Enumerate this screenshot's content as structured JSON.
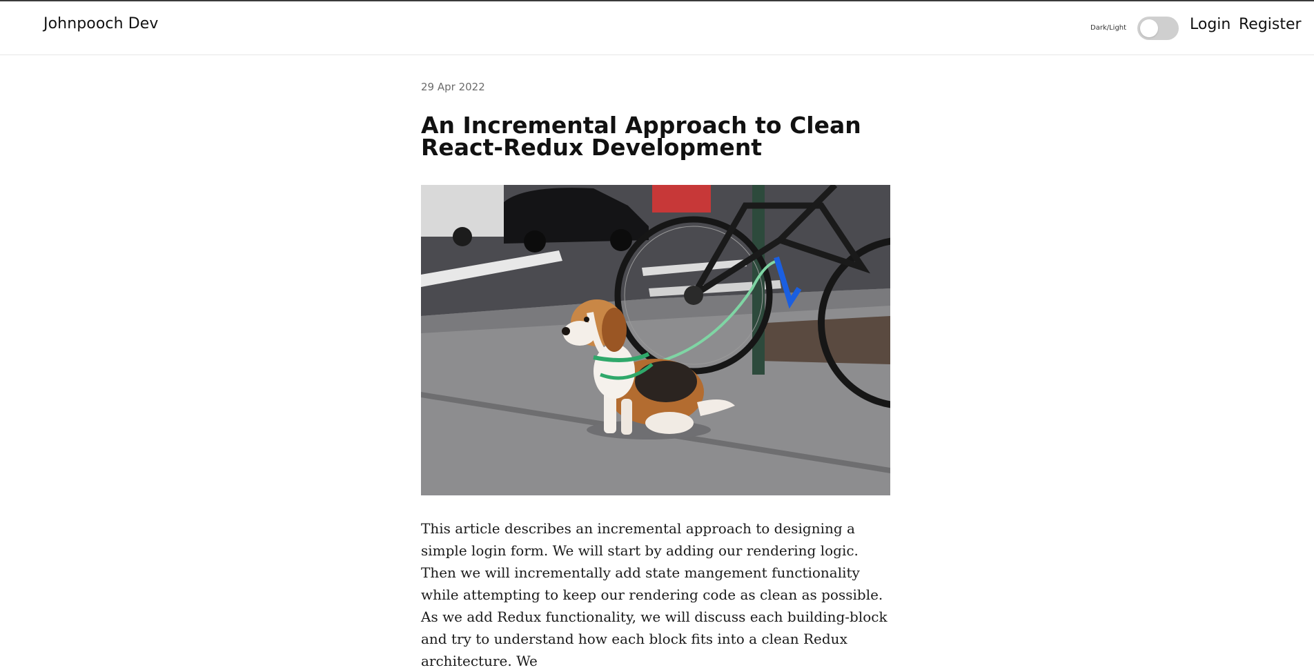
{
  "header": {
    "brand": "Johnpooch Dev",
    "theme_toggle_label": "Dark/Light",
    "theme_dark": false,
    "login_label": "Login",
    "register_label": "Register"
  },
  "post": {
    "date": "29 Apr 2022",
    "title": "An Incremental Approach to Clean React-Redux Development",
    "hero_image": "beagle-tied-to-bicycle-photo",
    "intro": "This article describes an incremental approach to designing a simple login form. We will start by adding our rendering logic. Then we will incrementally add state mangement functionality while attempting to keep our rendering code as clean as possible. As we add Redux functionality, we will discuss each building-block and try to understand how each block fits into a clean Redux architecture. We"
  },
  "colors": {
    "toggle_off": "#cfcfcf",
    "text": "#111111",
    "date": "#6b6b6b"
  }
}
